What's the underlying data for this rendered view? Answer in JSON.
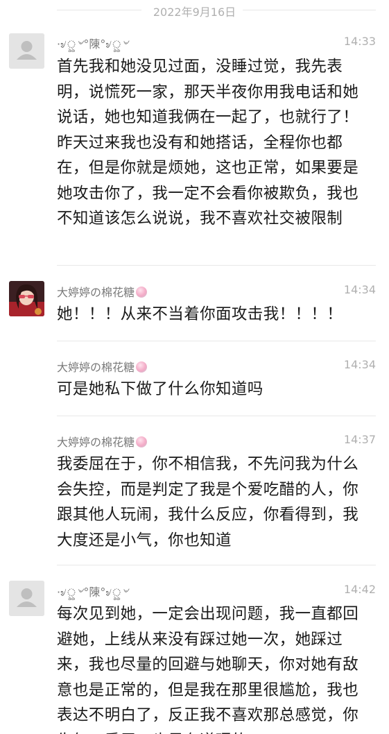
{
  "date_divider": "2022年9月16日",
  "messages": [
    {
      "sender": "·৶ৣ৺°陳°৶ৣ৺",
      "time": "14:33",
      "text": "首先我和她没见过面，没睡过觉，我先表明，说慌死一家，那天半夜你用我电话和她说话，她也知道我俩在一起了，也就行了！昨天过来我也没有和她搭话，全程你也都在，但是你就是烦她，这也正常，如果要是她攻击你了，我一定不会看你被欺负，我也不知道该怎么说说，我不喜欢社交被限制",
      "avatar": "default-avatar-icon"
    },
    {
      "sender": "大婷婷の棉花糖",
      "time": "14:34",
      "text": "她！！！从来不当着你面攻击我！！！！",
      "avatar": "user-photo-avatar"
    },
    {
      "sender": "大婷婷の棉花糖",
      "time": "14:34",
      "text": "可是她私下做了什么你知道吗"
    },
    {
      "sender": "大婷婷の棉花糖",
      "time": "14:37",
      "text": "我委屈在于，你不相信我，不先问我为什么会失控，而是判定了我是个爱吃醋的人，你跟其他人玩闹，我什么反应，你看得到，我大度还是小气，你也知道"
    },
    {
      "sender": "·৶ৣ৺°陳°৶ৣ৺",
      "time": "14:42",
      "text": "每次见到她，一定会出现问题，我一直都回避她，上线从来没有踩过她一次，她踩过来，我也尽量的回避与她聊天，你对她有敌意也是正常的，但是我在那里很尴尬，我也表达不明白了，反正我不喜欢那总感觉，你生气，委屈，也是有道理的",
      "avatar": "default-avatar-icon"
    }
  ]
}
